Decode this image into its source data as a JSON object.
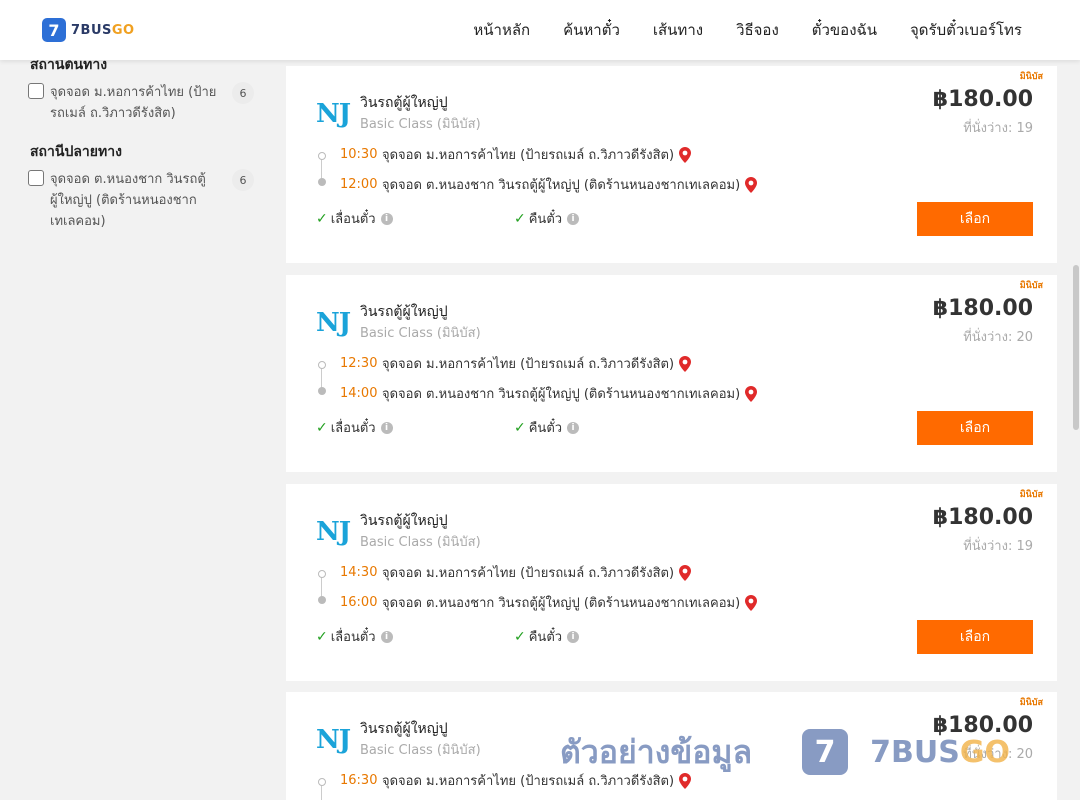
{
  "app": {
    "logo_badge": "7",
    "logo_brand_main": "7BUS",
    "logo_brand_go": "GO"
  },
  "nav": {
    "items": [
      "หน้าหลัก",
      "ค้นหาตั๋ว",
      "เส้นทาง",
      "วิธีจอง",
      "ตั๋วของฉัน",
      "จุดรับตั๋วเบอร์โทร"
    ]
  },
  "sidebar": {
    "origin_title": "สถานีต้นทาง",
    "origin_option": {
      "label": "จุดจอด ม.หอการค้าไทย (ป้ายรถเมล์ ถ.วิภาวดีรังสิต)",
      "count": "6",
      "checked": false
    },
    "destination_title": "สถานีปลายทาง",
    "destination_option": {
      "label": "จุดจอด ต.หนองชาก วินรถตู้ผู้ใหญ่ปู (ติดร้านหนองชากเทเลคอม)",
      "count": "6",
      "checked": false
    }
  },
  "trips": [
    {
      "tag": "มินิบัส",
      "operator_logo": "NJ",
      "operator": "วินรถตู้ผู้ใหญ่ปู",
      "class": "Basic Class (มินิบัส)",
      "price": "฿180.00",
      "seats": "ที่นั่งว่าง: 19",
      "depart_time": "10:30",
      "depart_stop": "จุดจอด ม.หอการค้าไทย (ป้ายรถเมล์ ถ.วิภาวดีรังสิต)",
      "arrive_time": "12:00",
      "arrive_stop": "จุดจอด ต.หนองชาก วินรถตู้ผู้ใหญ่ปู (ติดร้านหนองชากเทเลคอม)",
      "feature1": "เลื่อนตั๋ว",
      "feature2": "คืนตั๋ว",
      "button": "เลือก"
    },
    {
      "tag": "มินิบัส",
      "operator_logo": "NJ",
      "operator": "วินรถตู้ผู้ใหญ่ปู",
      "class": "Basic Class (มินิบัส)",
      "price": "฿180.00",
      "seats": "ที่นั่งว่าง: 20",
      "depart_time": "12:30",
      "depart_stop": "จุดจอด ม.หอการค้าไทย (ป้ายรถเมล์ ถ.วิภาวดีรังสิต)",
      "arrive_time": "14:00",
      "arrive_stop": "จุดจอด ต.หนองชาก วินรถตู้ผู้ใหญ่ปู (ติดร้านหนองชากเทเลคอม)",
      "feature1": "เลื่อนตั๋ว",
      "feature2": "คืนตั๋ว",
      "button": "เลือก"
    },
    {
      "tag": "มินิบัส",
      "operator_logo": "NJ",
      "operator": "วินรถตู้ผู้ใหญ่ปู",
      "class": "Basic Class (มินิบัส)",
      "price": "฿180.00",
      "seats": "ที่นั่งว่าง: 19",
      "depart_time": "14:30",
      "depart_stop": "จุดจอด ม.หอการค้าไทย (ป้ายรถเมล์ ถ.วิภาวดีรังสิต)",
      "arrive_time": "16:00",
      "arrive_stop": "จุดจอด ต.หนองชาก วินรถตู้ผู้ใหญ่ปู (ติดร้านหนองชากเทเลคอม)",
      "feature1": "เลื่อนตั๋ว",
      "feature2": "คืนตั๋ว",
      "button": "เลือก"
    },
    {
      "tag": "มินิบัส",
      "operator_logo": "NJ",
      "operator": "วินรถตู้ผู้ใหญ่ปู",
      "class": "Basic Class (มินิบัส)",
      "price": "฿180.00",
      "seats": "ที่นั่งว่าง: 20",
      "depart_time": "16:30",
      "depart_stop": "จุดจอด ม.หอการค้าไทย (ป้ายรถเมล์ ถ.วิภาวดีรังสิต)",
      "arrive_time": "",
      "arrive_stop": "",
      "feature1": "",
      "feature2": "",
      "button": ""
    }
  ],
  "watermark": {
    "text": "ตัวอย่างข้อมูล",
    "badge": "7",
    "brand_main": "7BUS",
    "brand_go": "GO"
  },
  "colors": {
    "accent_orange": "#ff6a00",
    "time_orange": "#e87800",
    "operator_blue": "#1aa3d9",
    "check_green": "#22a020",
    "pin_red": "#e02a2a"
  }
}
